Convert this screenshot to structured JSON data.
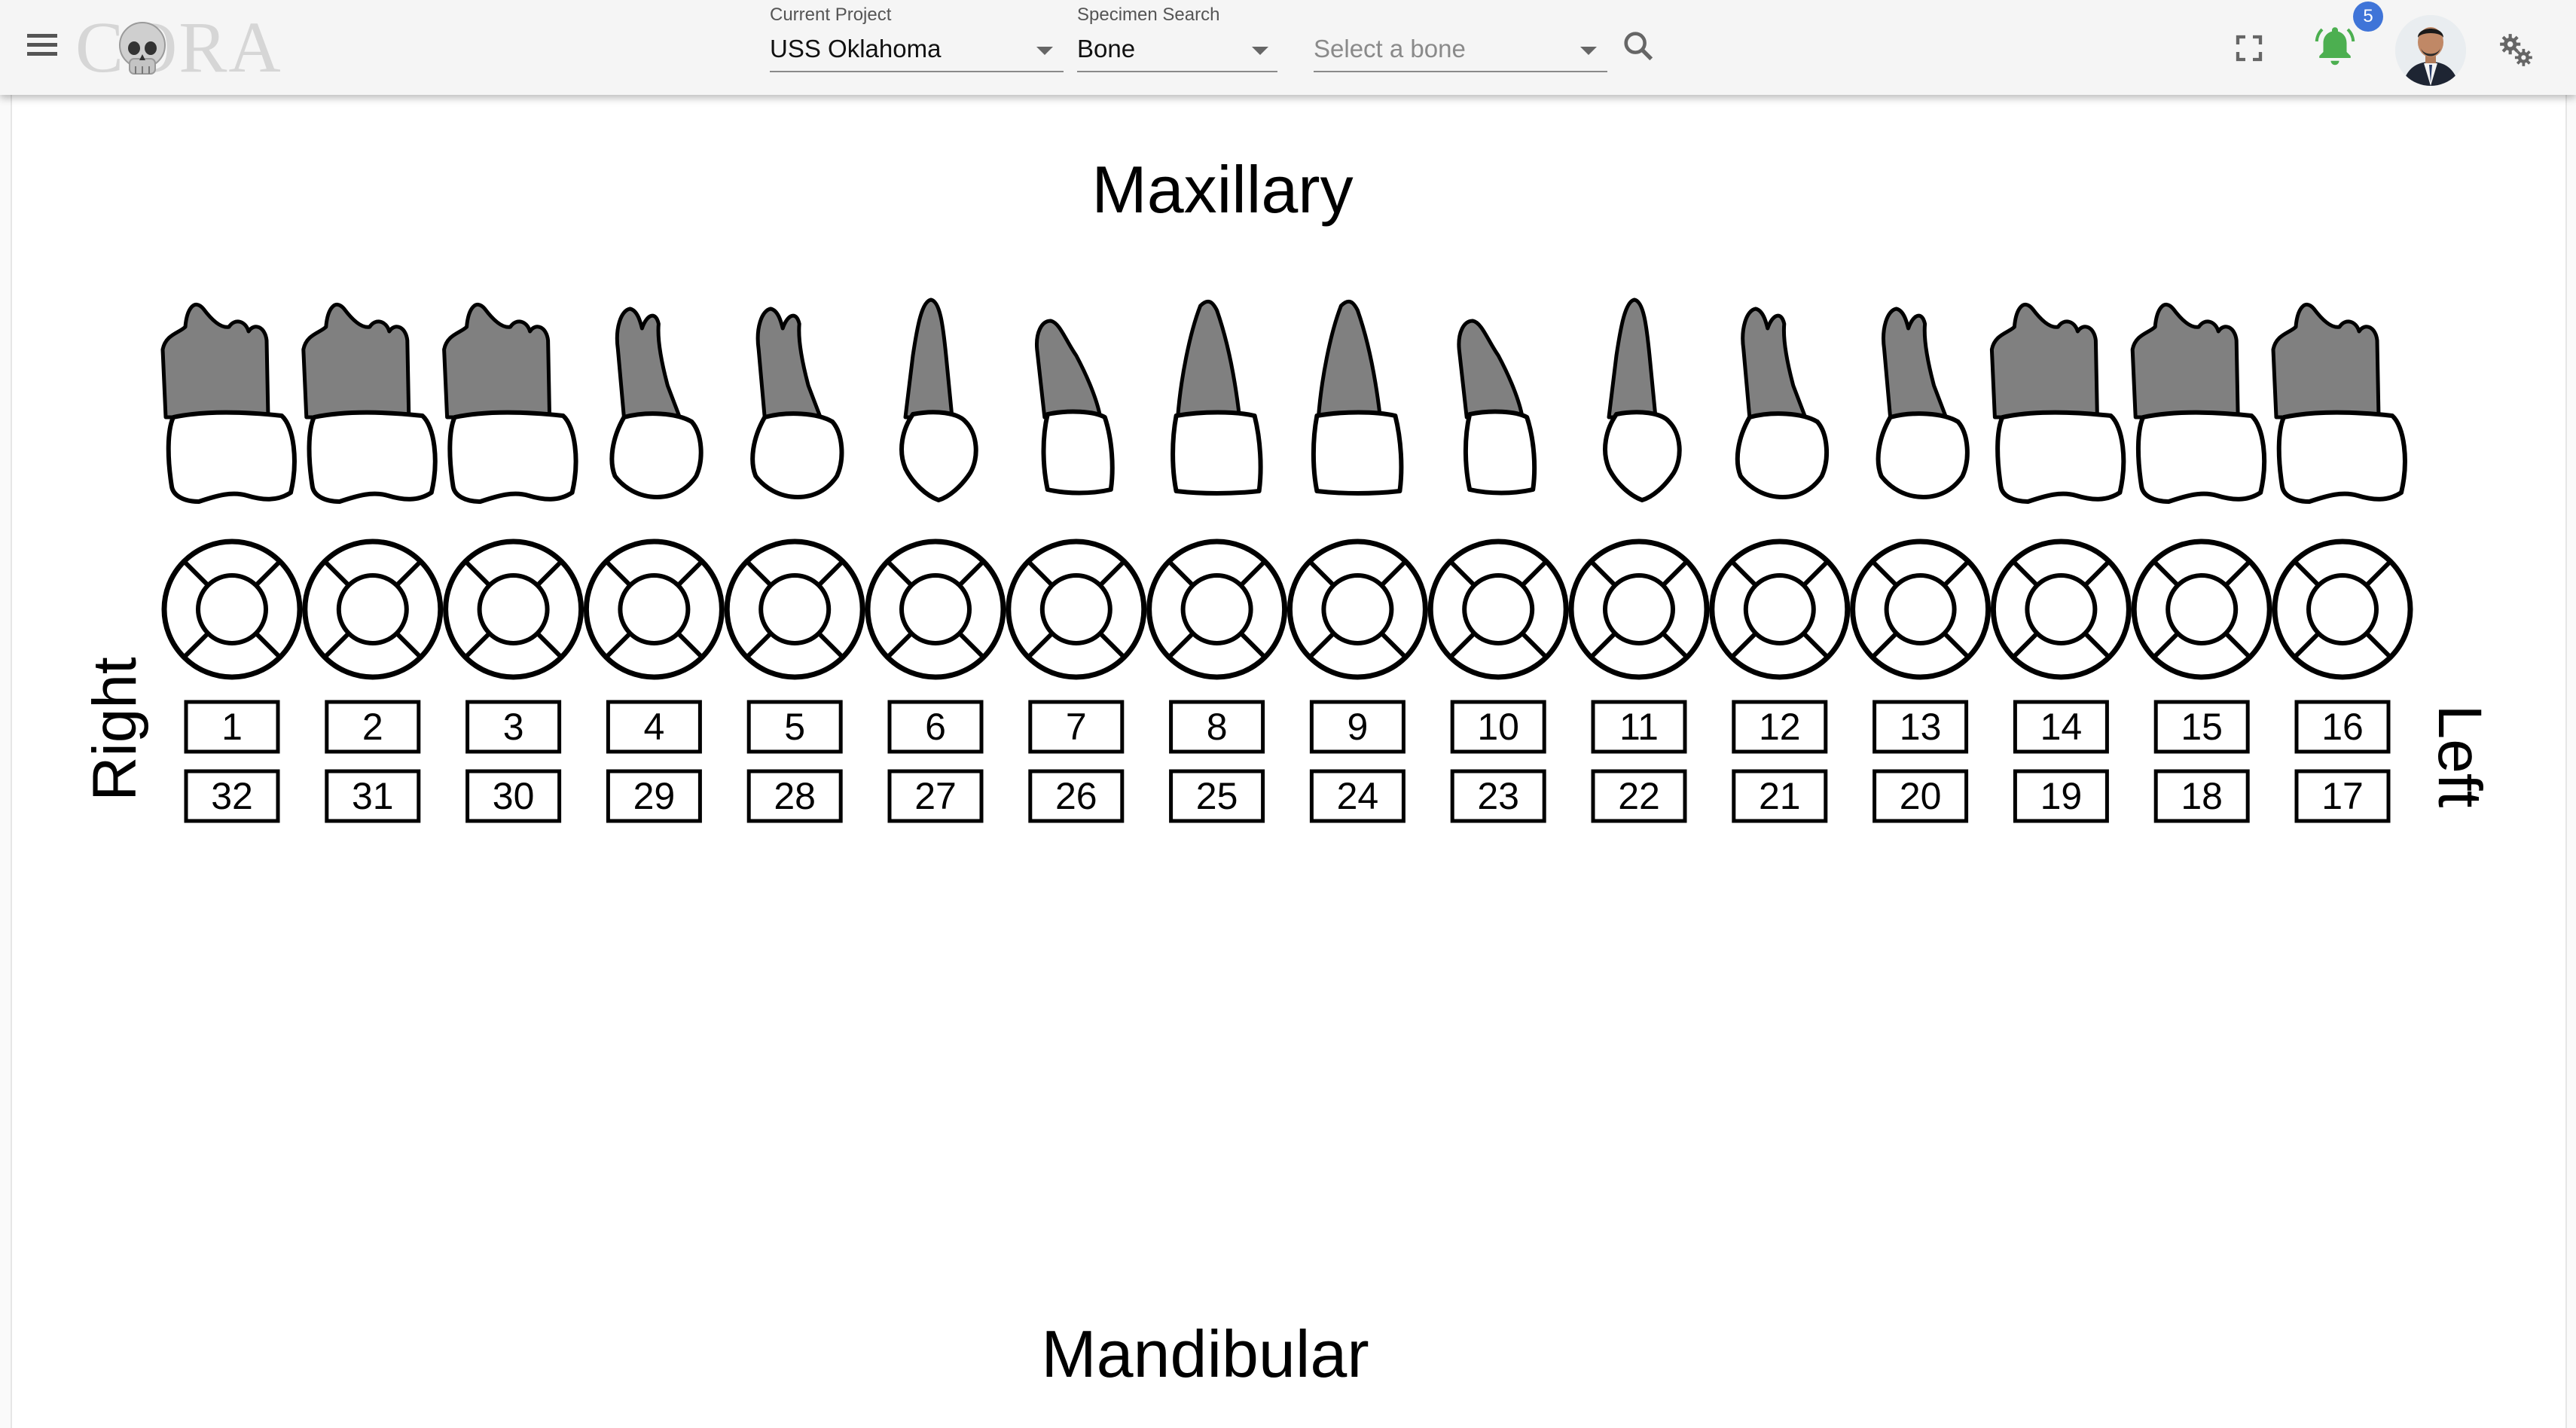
{
  "header": {
    "menu_icon": "hamburger-menu-icon",
    "logo_text": "CORA",
    "project_label": "Current Project",
    "project_value": "USS Oklahoma",
    "specimen_label": "Specimen Search",
    "specimen_value": "Bone",
    "bone_placeholder": "Select a bone",
    "search_icon": "search-icon",
    "fullscreen_icon": "fullscreen-icon",
    "notification_icon": "bell-icon",
    "notification_count": "5",
    "notification_color": "#4caf50",
    "badge_color": "#3f74d8",
    "settings_icon": "gears-icon"
  },
  "dental_chart": {
    "upper_title": "Maxillary",
    "lower_title": "Mandibular",
    "right_label": "Right",
    "left_label": "Left",
    "root_color": "#808080",
    "maxillary_numbers": [
      "1",
      "2",
      "3",
      "4",
      "5",
      "6",
      "7",
      "8",
      "9",
      "10",
      "11",
      "12",
      "13",
      "14",
      "15",
      "16"
    ],
    "mandibular_numbers": [
      "32",
      "31",
      "30",
      "29",
      "28",
      "27",
      "26",
      "25",
      "24",
      "23",
      "22",
      "21",
      "20",
      "19",
      "18",
      "17"
    ],
    "tooth_types": [
      "molar",
      "molar",
      "molar",
      "premolar",
      "premolar",
      "canine",
      "lateral",
      "central",
      "central",
      "lateral",
      "canine",
      "premolar",
      "premolar",
      "molar",
      "molar",
      "molar"
    ]
  }
}
